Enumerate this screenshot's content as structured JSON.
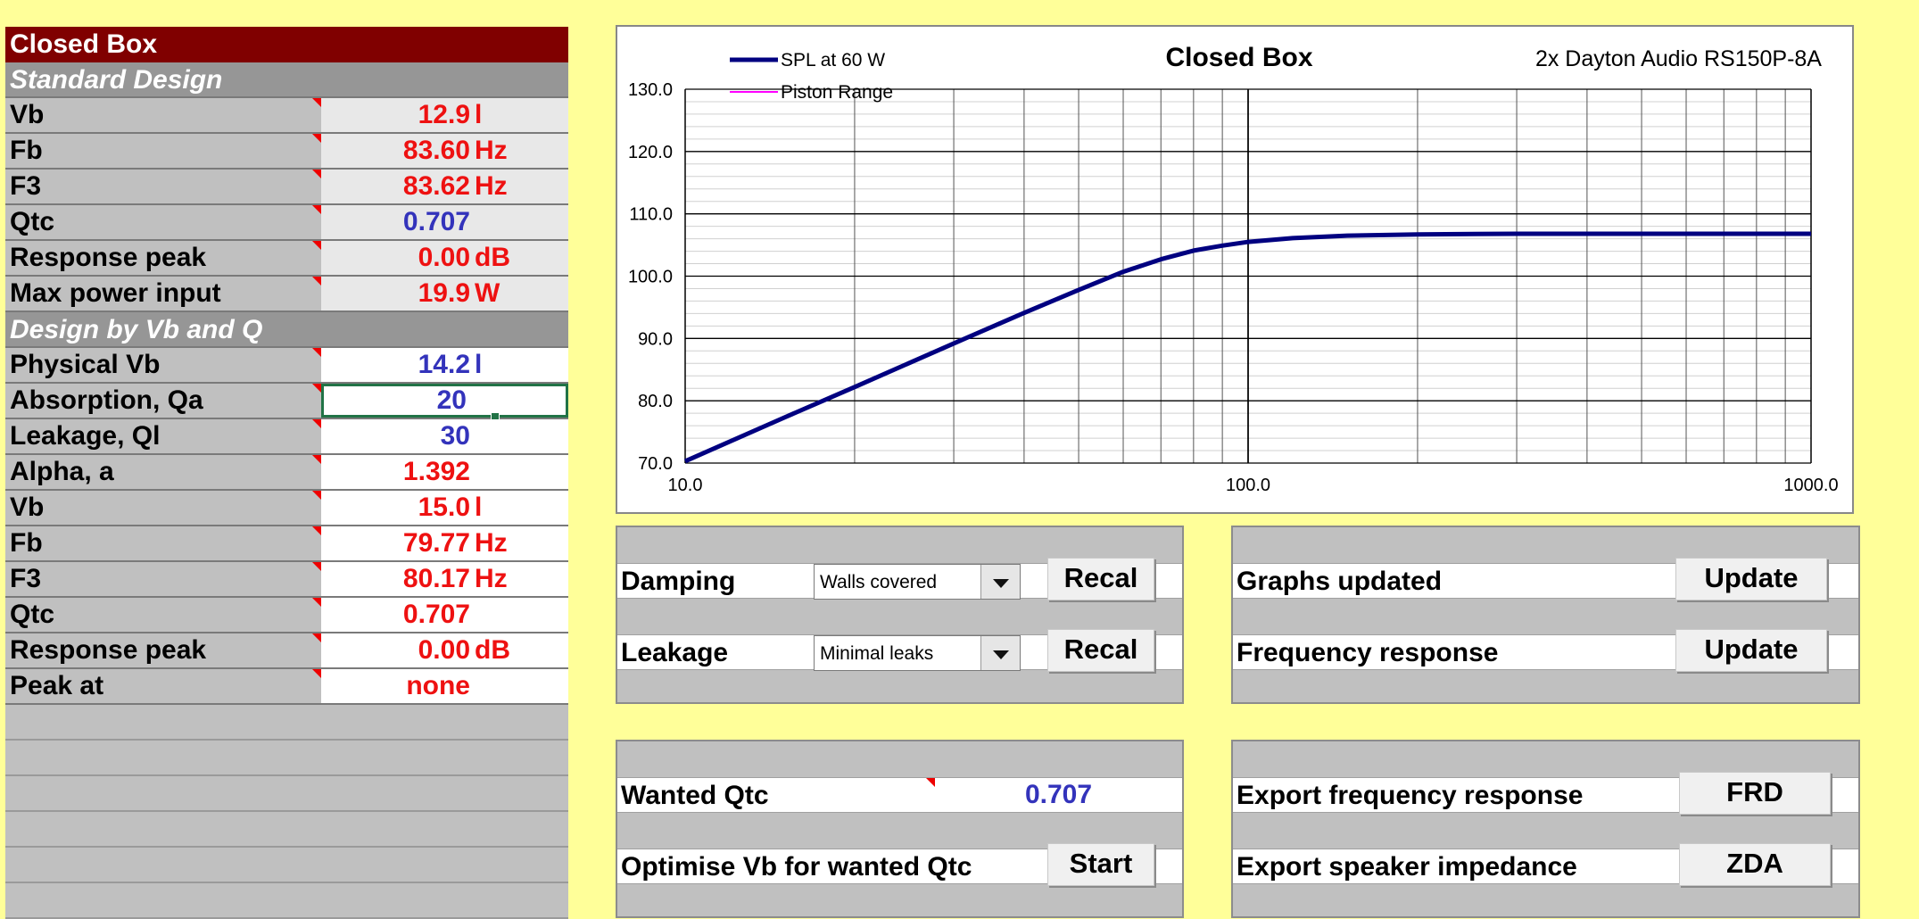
{
  "left_table": {
    "title": "Closed Box",
    "standard_design": {
      "header": "Standard Design",
      "rows": [
        {
          "label": "Vb",
          "value": "12.9",
          "unit": "l",
          "color": "red"
        },
        {
          "label": "Fb",
          "value": "83.60",
          "unit": "Hz",
          "color": "red"
        },
        {
          "label": "F3",
          "value": "83.62",
          "unit": "Hz",
          "color": "red"
        },
        {
          "label": "Qtc",
          "value": "0.707",
          "unit": "",
          "color": "blue"
        },
        {
          "label": "Response peak",
          "value": "0.00",
          "unit": "dB",
          "color": "red"
        },
        {
          "label": "Max power input",
          "value": "19.9",
          "unit": "W",
          "color": "red"
        }
      ]
    },
    "design_vb_q": {
      "header": "Design by Vb and Q",
      "rows": [
        {
          "label": "Physical Vb",
          "value": "14.2",
          "unit": "l",
          "color": "blue"
        },
        {
          "label": "Absorption, Qa",
          "value": "20",
          "unit": "",
          "color": "blue"
        },
        {
          "label": "Leakage, Ql",
          "value": "30",
          "unit": "",
          "color": "blue"
        },
        {
          "label": "Alpha, a",
          "value": "1.392",
          "unit": "",
          "color": "red"
        },
        {
          "label": "Vb",
          "value": "15.0",
          "unit": "l",
          "color": "red"
        },
        {
          "label": "Fb",
          "value": "79.77",
          "unit": "Hz",
          "color": "red"
        },
        {
          "label": "F3",
          "value": "80.17",
          "unit": "Hz",
          "color": "red"
        },
        {
          "label": "Qtc",
          "value": "0.707",
          "unit": "",
          "color": "red"
        },
        {
          "label": "Response peak",
          "value": "0.00",
          "unit": "dB",
          "color": "red"
        },
        {
          "label": "Peak at",
          "value": "none",
          "unit": "",
          "color": "red"
        }
      ]
    }
  },
  "chart_data": {
    "type": "line",
    "title": "Closed Box",
    "subtitle": "2x Dayton Audio RS150P-8A",
    "x_scale": "log",
    "xlim": [
      10,
      1000
    ],
    "ylim": [
      70,
      130
    ],
    "x_tick_labels": [
      "10.0",
      "100.0",
      "1000.0"
    ],
    "y_tick_labels": [
      "130.0",
      "120.0",
      "110.0",
      "100.0",
      "90.0",
      "80.0",
      "70.0"
    ],
    "grid": true,
    "legend_position": "top-left",
    "series": [
      {
        "name": "SPL at 60 W",
        "color": "#000080",
        "x": [
          10,
          15,
          20,
          30,
          40,
          50,
          60,
          70,
          80,
          90,
          100,
          120,
          150,
          200,
          300,
          500,
          1000
        ],
        "y": [
          70.3,
          77.3,
          82.2,
          89.2,
          94.1,
          97.8,
          100.7,
          102.7,
          104.1,
          104.9,
          105.5,
          106.1,
          106.5,
          106.7,
          106.8,
          106.8,
          106.8
        ]
      },
      {
        "name": "Piston Range",
        "color": "#ff00ff",
        "x": [],
        "y": []
      }
    ]
  },
  "damping_panel": {
    "damping_label": "Damping",
    "damping_value": "Walls covered",
    "leakage_label": "Leakage",
    "leakage_value": "Minimal leaks",
    "recal_label": "Recal"
  },
  "update_panel": {
    "graphs_label": "Graphs updated",
    "freq_label": "Frequency response",
    "update_label": "Update"
  },
  "qtc_panel": {
    "wanted_label": "Wanted Qtc",
    "wanted_value": "0.707",
    "optimise_label": "Optimise Vb for wanted Qtc",
    "start_label": "Start"
  },
  "export_panel": {
    "freq_label": "Export frequency response",
    "freq_button": "FRD",
    "imp_label": "Export speaker impedance",
    "imp_button": "ZDA"
  }
}
